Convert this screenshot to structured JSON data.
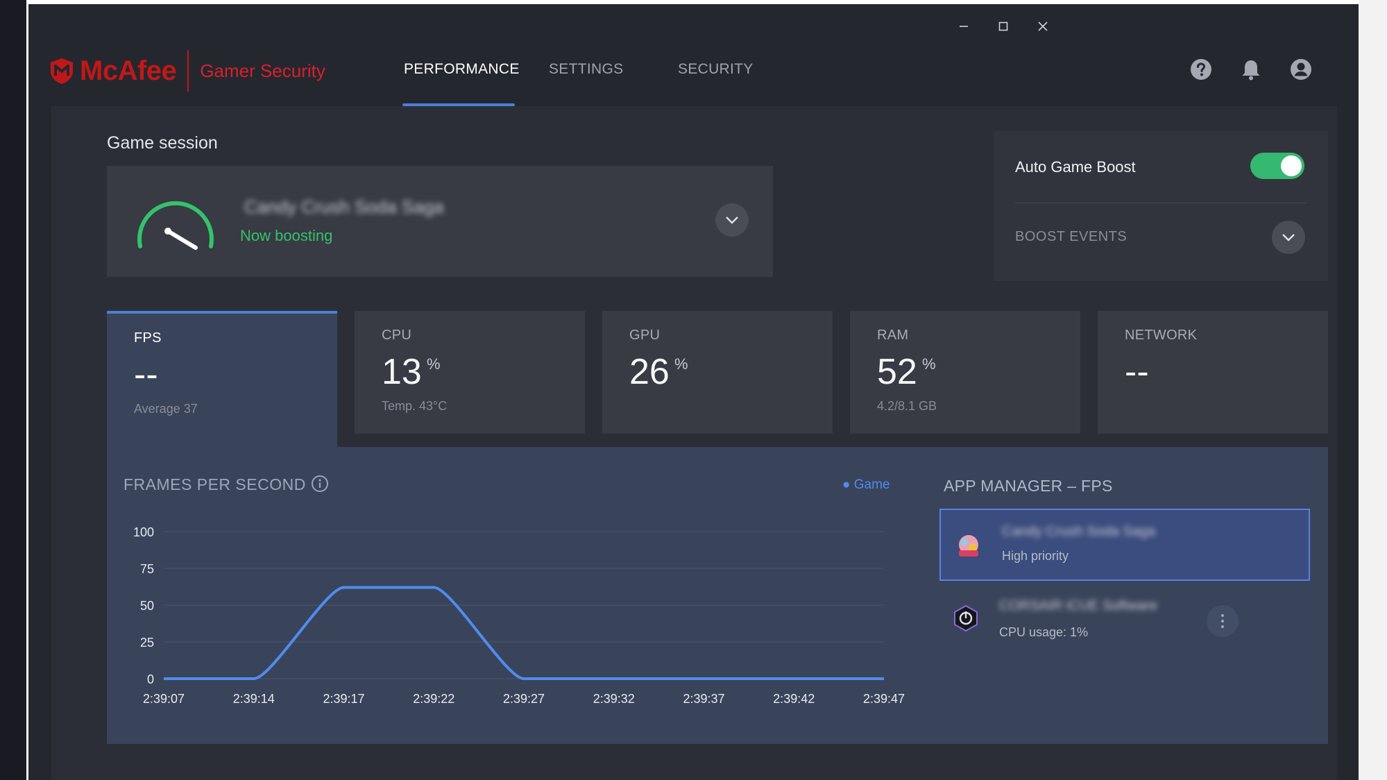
{
  "window": {
    "controls": {
      "minimize": "minimize-icon",
      "maximize": "maximize-icon",
      "close": "close-icon"
    }
  },
  "header": {
    "brand": "McAfee",
    "product": "Gamer Security",
    "tabs": [
      {
        "label": "PERFORMANCE",
        "active": true
      },
      {
        "label": "SETTINGS",
        "active": false
      },
      {
        "label": "SECURITY",
        "active": false
      }
    ],
    "icons": [
      "help-icon",
      "bell-icon",
      "account-icon"
    ]
  },
  "session": {
    "title": "Game session",
    "game_name": "Candy Crush Soda Saga",
    "status": "Now boosting"
  },
  "boost": {
    "auto_label": "Auto Game Boost",
    "auto_enabled": true,
    "events_label": "BOOST EVENTS"
  },
  "stats": [
    {
      "label": "FPS",
      "value": "--",
      "unit": "",
      "sub": "Average 37",
      "active": true
    },
    {
      "label": "CPU",
      "value": "13",
      "unit": "%",
      "sub": "Temp. 43°C",
      "active": false
    },
    {
      "label": "GPU",
      "value": "26",
      "unit": "%",
      "sub": "",
      "active": false
    },
    {
      "label": "RAM",
      "value": "52",
      "unit": "%",
      "sub": "4.2/8.1 GB",
      "active": false
    },
    {
      "label": "NETWORK",
      "value": "--",
      "unit": "",
      "sub": "",
      "active": false
    }
  ],
  "chart_data": {
    "type": "line",
    "title": "FRAMES PER SECOND",
    "xlabel": "",
    "ylabel": "",
    "categories": [
      "2:39:07",
      "2:39:14",
      "2:39:17",
      "2:39:22",
      "2:39:27",
      "2:39:32",
      "2:39:37",
      "2:39:42",
      "2:39:47"
    ],
    "yticks": [
      0,
      25,
      50,
      75,
      100
    ],
    "ylim": [
      0,
      100
    ],
    "grid": true,
    "legend_position": "top-right",
    "series": [
      {
        "name": "Game",
        "color": "#4f8cf0",
        "values": [
          0,
          0,
          62,
          62,
          0,
          0,
          0,
          0,
          0
        ]
      }
    ]
  },
  "app_manager": {
    "title": "APP MANAGER – FPS",
    "apps": [
      {
        "name": "Candy Crush Soda Saga",
        "status": "High priority",
        "selected": true
      },
      {
        "name": "CORSAIR iCUE Software",
        "status": "CPU usage:  1%",
        "selected": false
      }
    ]
  },
  "colors": {
    "accent": "#4a7fd8",
    "brand_red": "#c01818",
    "success_green": "#34c26a",
    "toggle_on": "#35b870",
    "chart_line": "#4f8cf0"
  }
}
